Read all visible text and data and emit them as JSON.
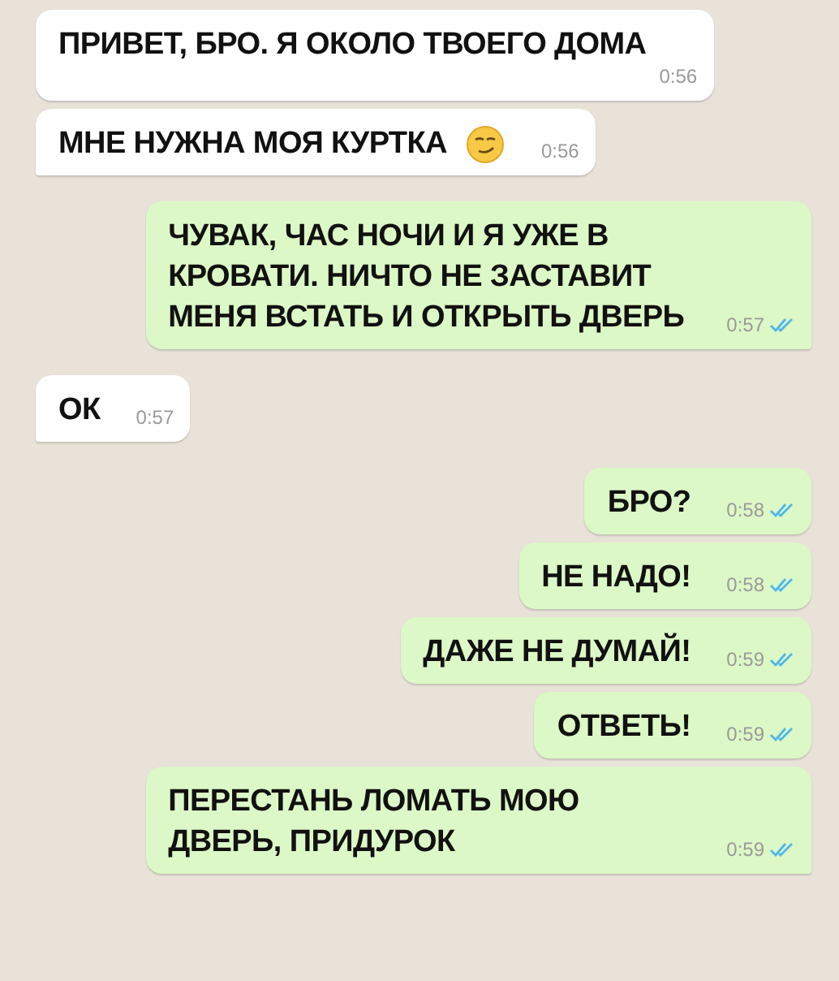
{
  "messages": [
    {
      "kind": "incoming",
      "text": "ПРИВЕТ, БРО. Я ОКОЛО ТВОЕГО ДОМА",
      "time": "0:56",
      "tail": false,
      "time_below": true
    },
    {
      "kind": "incoming_emoji",
      "text": "МНЕ НУЖНА МОЯ КУРТКА",
      "time": "0:56",
      "tail": true
    },
    {
      "kind": "outgoing",
      "text": "ЧУВАК, ЧАС НОЧИ И Я УЖЕ В КРОВАТИ. НИЧТО НЕ ЗАСТАВИТ МЕНЯ ВСТАТЬ И ОТКРЫТЬ ДВЕРЬ",
      "time": "0:57",
      "read": true,
      "tail": true
    },
    {
      "kind": "incoming",
      "text": "ОК",
      "time": "0:57",
      "tail": true
    },
    {
      "kind": "outgoing",
      "text": "БРО?",
      "time": "0:58",
      "read": true,
      "tail": false
    },
    {
      "kind": "outgoing",
      "text": "НЕ НАДО!",
      "time": "0:58",
      "read": true,
      "tail": false
    },
    {
      "kind": "outgoing",
      "text": "ДАЖЕ НЕ ДУМАЙ!",
      "time": "0:59",
      "read": true,
      "tail": false
    },
    {
      "kind": "outgoing",
      "text": "ОТВЕТЬ!",
      "time": "0:59",
      "read": true,
      "tail": false
    },
    {
      "kind": "outgoing",
      "text": "ПЕРЕСТАНЬ ЛОМАТЬ МОЮ ДВЕРЬ, ПРИДУРОК",
      "time": "0:59",
      "read": true,
      "tail": true
    }
  ]
}
